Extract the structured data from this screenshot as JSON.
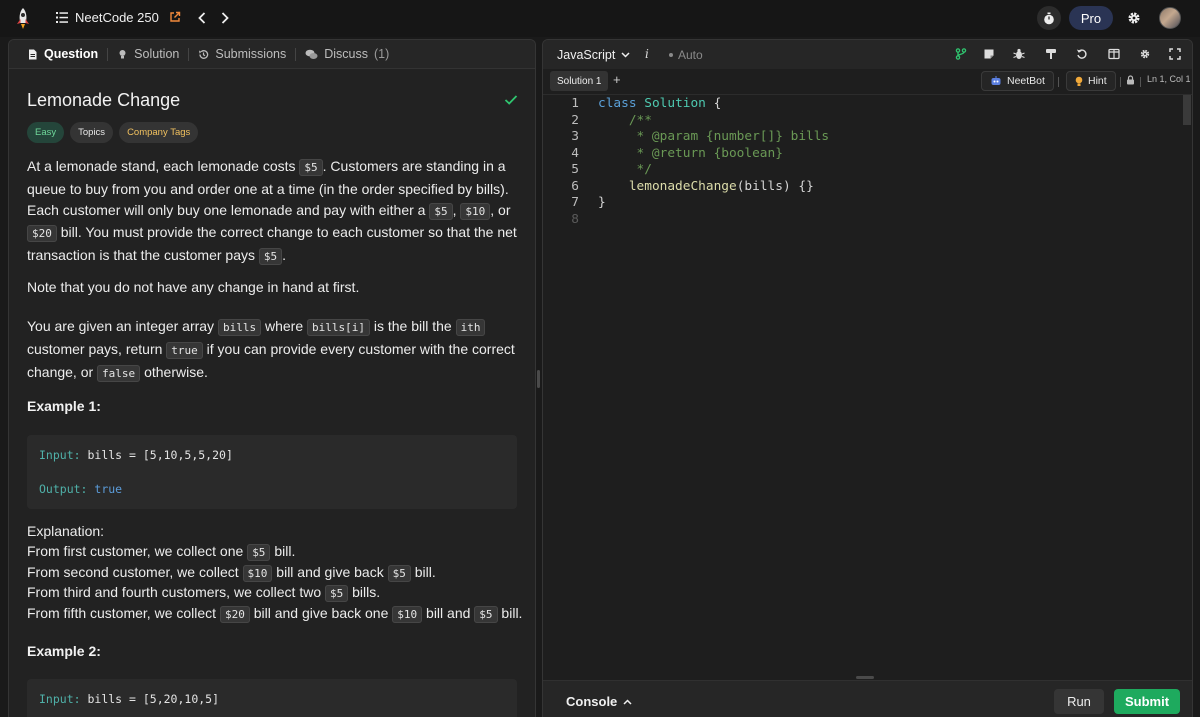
{
  "header": {
    "list_title": "NeetCode 250",
    "pro_label": "Pro"
  },
  "tabs": [
    {
      "label": "Question"
    },
    {
      "label": "Solution"
    },
    {
      "label": "Submissions"
    },
    {
      "label": "Discuss",
      "count": "(1)"
    }
  ],
  "problem": {
    "title": "Lemonade Change",
    "tags": [
      "Easy",
      "Topics",
      "Company Tags"
    ],
    "p1": {
      "a": "At a lemonade stand, each lemonade costs ",
      "c1": "$5",
      "b": ". Customers are standing in a queue to buy from you and order one at a time (in the order specified by bills). Each customer will only buy one lemonade and pay with either a ",
      "c2": "$5",
      "sep1": ", ",
      "c3": "$10",
      "sep2": ", or ",
      "c4": "$20",
      "d": " bill. You must provide the correct change to each customer so that the net transaction is that the customer pays ",
      "c5": "$5",
      "e": "."
    },
    "p2": "Note that you do not have any change in hand at first.",
    "p3": {
      "a": "You are given an integer array ",
      "c1": "bills",
      "b": " where ",
      "c2": "bills[i]",
      "c": " is the bill the ",
      "c3": "ith",
      "d": " customer pays, return ",
      "c4": "true",
      "e": " if you can provide every customer with the correct change, or ",
      "c5": "false",
      "f": " otherwise."
    },
    "example1": {
      "heading": "Example 1:",
      "input_label": "Input:",
      "input_value": " bills = [5,10,5,5,20]",
      "output_label": "Output:",
      "output_value": "true",
      "explanation_title": "Explanation:",
      "lines": [
        {
          "a": "From first customer, we collect one ",
          "c1": "$5",
          "b": " bill."
        },
        {
          "a": "From second customer, we collect ",
          "c1": "$10",
          "b": " bill and give back ",
          "c2": "$5",
          "c": " bill."
        },
        {
          "a": "From third and fourth customers, we collect two ",
          "c1": "$5",
          "b": " bills."
        },
        {
          "a": "From fifth customer, we collect ",
          "c1": "$20",
          "b": " bill and give back one ",
          "c2": "$10",
          "c": " bill and ",
          "c3": "$5",
          "d": " bill."
        }
      ]
    },
    "example2": {
      "heading": "Example 2:",
      "input_label": "Input:",
      "input_value": " bills = [5,20,10,5]"
    }
  },
  "editor": {
    "language": "JavaScript",
    "info": "i",
    "mode": "Auto",
    "solution_tab": "Solution 1",
    "add_tab": "+",
    "neetbot": "NeetBot",
    "hint": "Hint",
    "position": "Ln 1, Col 1",
    "line_numbers": [
      "1",
      "2",
      "3",
      "4",
      "5",
      "6",
      "7",
      "8"
    ],
    "code": {
      "l1_kw": "class",
      "l1_cls": "Solution",
      "l1_rest": " {",
      "l2": "    /**",
      "l3": "     * @param {number[]} bills",
      "l4": "     * @return {boolean}",
      "l5": "     */",
      "l6_indent": "    ",
      "l6_fn": "lemonadeChange",
      "l6_open": "(",
      "l6_param": "bills",
      "l6_close": ") {}",
      "l7": "}"
    }
  },
  "bottom": {
    "console": "Console",
    "run": "Run",
    "submit": "Submit"
  },
  "colors": {
    "accent_green": "#1eaa5e",
    "easy_green": "#6fd79a",
    "pro_bg": "#2a3454"
  }
}
